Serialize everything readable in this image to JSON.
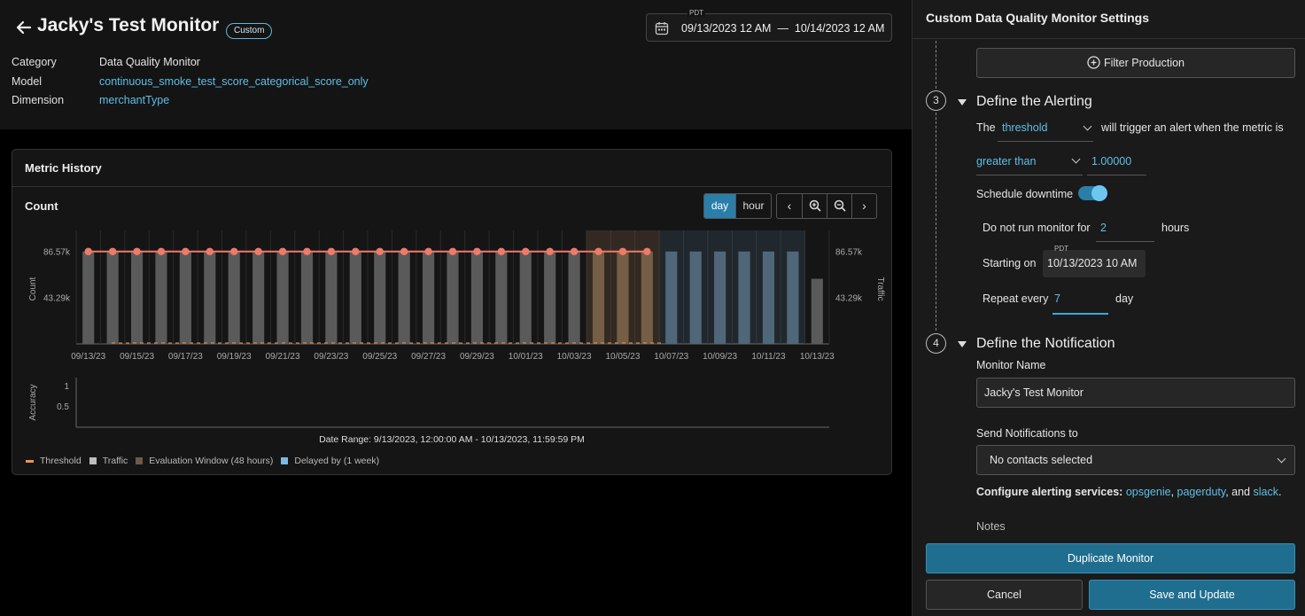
{
  "header": {
    "title": "Jacky's Test Monitor",
    "badge": "Custom",
    "meta": [
      {
        "key": "Category",
        "value": "Data Quality Monitor"
      },
      {
        "key": "Model",
        "value": "continuous_smoke_test_score_categorical_score_only"
      },
      {
        "key": "Dimension",
        "value": "merchantType"
      }
    ],
    "timezone": "PDT",
    "date_from": "09/13/2023 12 AM",
    "date_sep": "—",
    "date_to": "10/14/2023 12 AM"
  },
  "card": {
    "title": "Metric History",
    "count_title": "Count",
    "granularity": [
      "day",
      "hour"
    ],
    "selected_granularity": "day",
    "nav_icons": [
      "chevron-left-icon",
      "zoom-in-icon",
      "zoom-out-icon",
      "chevron-right-icon"
    ],
    "date_range": "Date Range: 9/13/2023, 12:00:00 AM - 10/13/2023, 11:59:59 PM",
    "legend": [
      {
        "label": "Threshold",
        "color": "#f0944f"
      },
      {
        "label": "Traffic",
        "color": "#bdbdbd"
      },
      {
        "label": "Evaluation Window (48 hours)",
        "color": "#6e5a44"
      },
      {
        "label": "Delayed by (1 week)",
        "color": "#7cb9df"
      }
    ]
  },
  "chart_data": [
    {
      "type": "bar",
      "ylabel": "Count",
      "y2label": "Traffic",
      "yticks": [
        "86.57k",
        "43.29k"
      ],
      "y2ticks": [
        "86.57k",
        "43.29k"
      ],
      "ylim": [
        0,
        103000
      ],
      "xticks": [
        "09/13/23",
        "09/15/23",
        "09/17/23",
        "09/19/23",
        "09/21/23",
        "09/23/23",
        "09/25/23",
        "09/27/23",
        "09/29/23",
        "10/01/23",
        "10/03/23",
        "10/05/23",
        "10/07/23",
        "10/09/23",
        "10/11/23",
        "10/13/23"
      ],
      "series": [
        {
          "name": "Traffic",
          "values": [
            86570,
            86570,
            86570,
            86570,
            86570,
            86570,
            86570,
            86570,
            86570,
            86570,
            86570,
            86570,
            86570,
            86570,
            86570,
            86570,
            86570,
            86570,
            86570,
            86570,
            86570,
            86570,
            86570,
            86570,
            86570,
            86570,
            86570,
            86570,
            86570,
            86570,
            61000
          ]
        },
        {
          "name": "Count",
          "values": [
            86570,
            86570,
            86570,
            86570,
            86570,
            86570,
            86570,
            86570,
            86570,
            86570,
            86570,
            86570,
            86570,
            86570,
            86570,
            86570,
            86570,
            86570,
            86570,
            86570,
            86570,
            86570,
            86570,
            86570
          ]
        }
      ],
      "evaluation_window_days": [
        21,
        22,
        23
      ],
      "delayed_days": [
        24,
        25,
        26,
        27,
        28,
        29
      ]
    },
    {
      "type": "line",
      "ylabel": "Accuracy",
      "yticks": [
        "1",
        "0.5"
      ],
      "ylim": [
        0,
        1.2
      ]
    }
  ],
  "panel": {
    "title": "Custom Data Quality Monitor Settings",
    "filter_button": "Filter Production",
    "step3": {
      "number": "3",
      "title": "Define the Alerting",
      "the": "The",
      "metric_select": "threshold",
      "trigger_text": "will trigger an alert  when the metric is",
      "operator_select": "greater than",
      "threshold_value": "1.00000",
      "schedule_downtime": "Schedule downtime",
      "schedule_on": true,
      "do_not_run": "Do not run monitor for",
      "hours_value": "2",
      "hours_unit": "hours",
      "starting_on": "Starting on",
      "start_tz": "PDT",
      "start_value": "10/13/2023 10 AM",
      "repeat_every": "Repeat every",
      "repeat_value": "7",
      "repeat_unit": "day"
    },
    "step4": {
      "number": "4",
      "title": "Define the Notification",
      "monitor_name_label": "Monitor Name",
      "monitor_name_value": "Jacky's Test Monitor",
      "send_label": "Send Notifications to",
      "send_value": "No contacts selected",
      "configure_label": "Configure alerting services:",
      "svc1": "opsgenie",
      "comma": ",",
      "svc2": "pagerduty",
      "and": ", and",
      "svc3": "slack",
      "period": ".",
      "notes_label": "Notes"
    },
    "buttons": {
      "duplicate": "Duplicate Monitor",
      "cancel": "Cancel",
      "save": "Save and Update"
    }
  }
}
